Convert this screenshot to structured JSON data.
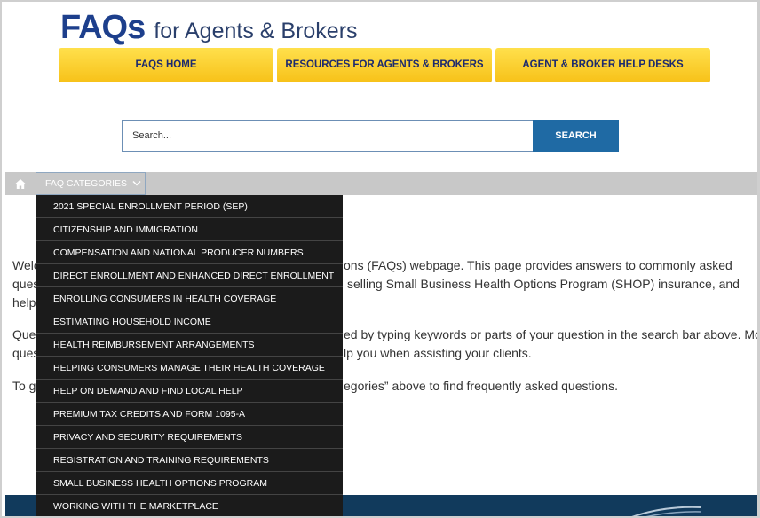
{
  "logo": {
    "faqs": "FAQs",
    "subtitle": "for Agents & Brokers"
  },
  "nav": [
    {
      "label": "FAQS HOME"
    },
    {
      "label": "RESOURCES FOR AGENTS & BROKERS"
    },
    {
      "label": "AGENT & BROKER HELP DESKS"
    }
  ],
  "search": {
    "placeholder": "Search...",
    "button": "SEARCH"
  },
  "category_bar": {
    "home_icon": "home-icon",
    "button": "FAQ CATEGORIES",
    "chevron_icon": "chevron-down-icon"
  },
  "dropdown": {
    "items": [
      "2021 SPECIAL ENROLLMENT PERIOD (SEP)",
      "CITIZENSHIP AND IMMIGRATION",
      "COMPENSATION AND NATIONAL PRODUCER NUMBERS",
      "DIRECT ENROLLMENT AND ENHANCED DIRECT ENROLLMENT",
      "ENROLLING CONSUMERS IN HEALTH COVERAGE",
      "ESTIMATING HOUSEHOLD INCOME",
      "HEALTH REIMBURSEMENT ARRANGEMENTS",
      "HELPING CONSUMERS MANAGE THEIR HEALTH COVERAGE",
      "HELP ON DEMAND AND FIND LOCAL HELP",
      "PREMIUM TAX CREDITS AND FORM 1095-A",
      "PRIVACY AND SECURITY REQUIREMENTS",
      "REGISTRATION AND TRAINING REQUIREMENTS",
      "SMALL BUSINESS HEALTH OPTIONS PROGRAM",
      "WORKING WITH THE MARKETPLACE"
    ]
  },
  "content": {
    "para1_line1_a": "Welc",
    "para1_line1_b": "ons (FAQs) webpage. This page provides answers to commonly asked",
    "para1_line2_a": "ques",
    "para1_line2_b": "selling Small Business Health Options Program (SHOP) insurance, and",
    "para1_line3_a": "help",
    "para2_line1_a": "Ques",
    "para2_line1_b": "ed by typing keywords or parts of your question in the search bar above. Most",
    "para2_line2_a": "ques",
    "para2_line2_b": "lp you when assisting your clients.",
    "para3_line1_a": "To g",
    "para3_line1_b": "egories” above to find frequently asked questions."
  },
  "colors": {
    "nav_yellow": "#f7c21a",
    "nav_text": "#1d2a6e",
    "search_button": "#1f6aa4",
    "dropdown_bg": "#1b1b1b",
    "category_bar": "#c8c8c8",
    "footer": "#113a5c",
    "logo_blue": "#1d3f8c"
  }
}
